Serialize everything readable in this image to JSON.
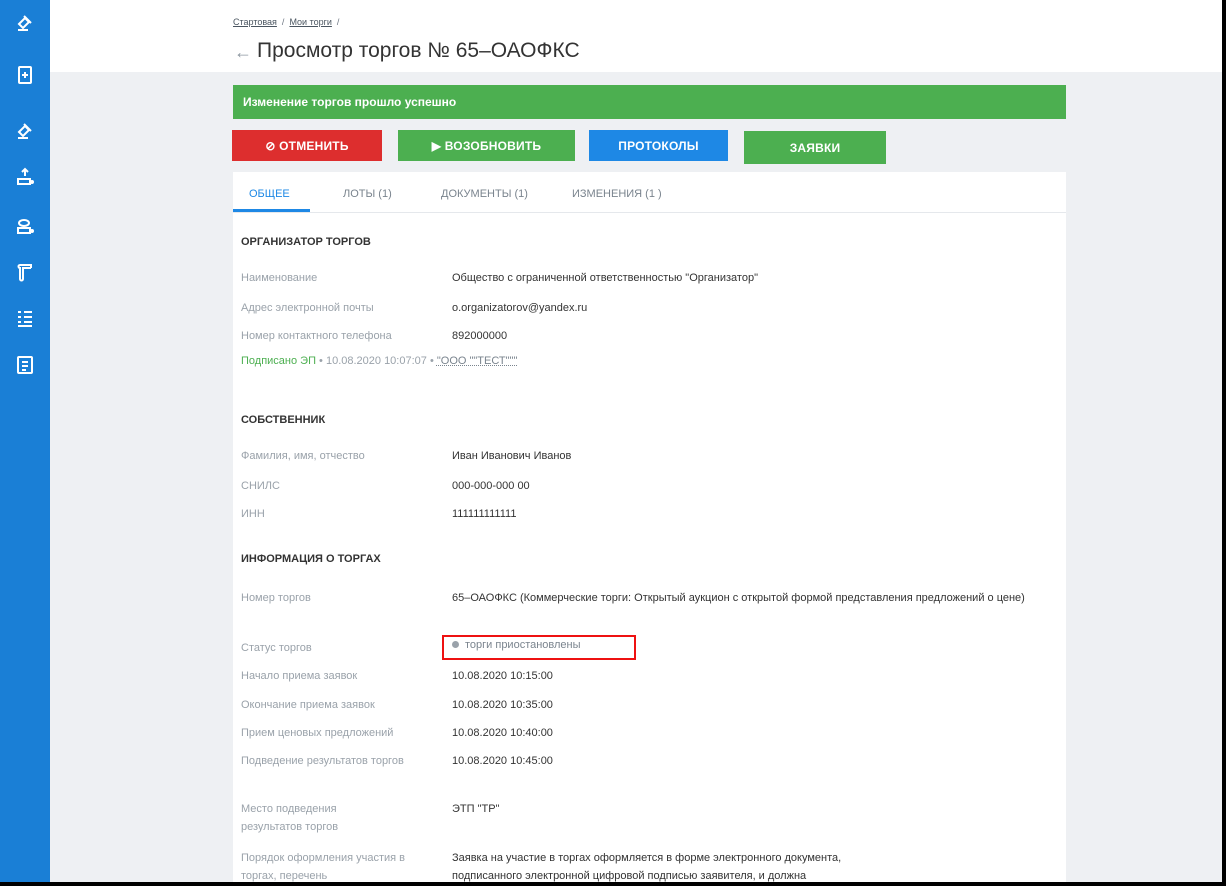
{
  "sidebar": {
    "accent": "#1a7fd6",
    "icons": [
      "gavel-icon",
      "document-icon",
      "gavel-icon",
      "upload-user-icon",
      "download-user-icon",
      "scroll-icon",
      "list-icon",
      "contract-icon"
    ]
  },
  "breadcrumb": {
    "home": "Стартовая",
    "sep1": "/",
    "my_trades": "Мои торги",
    "sep2": "/"
  },
  "header": {
    "back_arrow": "←",
    "title": "Просмотр торгов № 65–ОАОФКС"
  },
  "alert": {
    "text": "Изменение торгов прошло успешно",
    "color": "#4caf50"
  },
  "actions": {
    "cancel": "⊘ ОТМЕНИТЬ",
    "resume": "▶ ВОЗОБНОВИТЬ",
    "protocols": "ПРОТОКОЛЫ",
    "applications": "ЗАЯВКИ"
  },
  "tabs": [
    {
      "label": "ОБЩЕЕ",
      "active": true
    },
    {
      "label": "ЛОТЫ (1)"
    },
    {
      "label": "ДОКУМЕНТЫ (1)"
    },
    {
      "label": "ИЗМЕНЕНИЯ (1 )"
    }
  ],
  "organizer": {
    "heading": "ОРГАНИЗАТОР ТОРГОВ",
    "name_label": "Наименование",
    "name_value": "Общество с ограниченной ответственностью \"Организатор\"",
    "email_label": "Адрес электронной почты",
    "email_value": "o.organizatorov@yandex.ru",
    "phone_label": "Номер контактного телефона",
    "phone_value": "892000000",
    "signed_label": "Подписано ЭП",
    "signed_date": "• 10.08.2020 10:07:07 •",
    "signed_org": "\"ООО \"\"ТЕСТ\"\"\""
  },
  "owner": {
    "heading": "СОБСТВЕННИК",
    "fio_label": "Фамилия, имя, отчество",
    "fio_value": "Иван Иванович Иванов",
    "snils_label": "СНИЛС",
    "snils_value": "000-000-000 00",
    "inn_label": "ИНН",
    "inn_value": "111111111111"
  },
  "trade_info": {
    "heading": "ИНФОРМАЦИЯ О ТОРГАХ",
    "number_label": "Номер торгов",
    "number_value": "65–ОАОФКС (Коммерческие торги: Открытый аукцион с открытой формой представления предложений о цене)",
    "status_label": "Статус торгов",
    "status_value": "торги приостановлены",
    "apps_start_label": "Начало приема заявок",
    "apps_start_value": "10.08.2020 10:15:00",
    "apps_end_label": "Окончание приема заявок",
    "apps_end_value": "10.08.2020 10:35:00",
    "bids_label": "Прием ценовых предложений",
    "bids_value": "10.08.2020 10:40:00",
    "results_label": "Подведение результатов торгов",
    "results_value": "10.08.2020 10:45:00",
    "place_label": "Место подведения результатов торгов",
    "place_value": "ЭТП \"ТР\"",
    "order_label": "Порядок оформления участия в торгах, перечень",
    "order_value": "Заявка на участие в торгах оформляется в форме электронного документа, подписанного электронной цифровой подписью заявителя, и должна содержать сведения и приложения"
  }
}
